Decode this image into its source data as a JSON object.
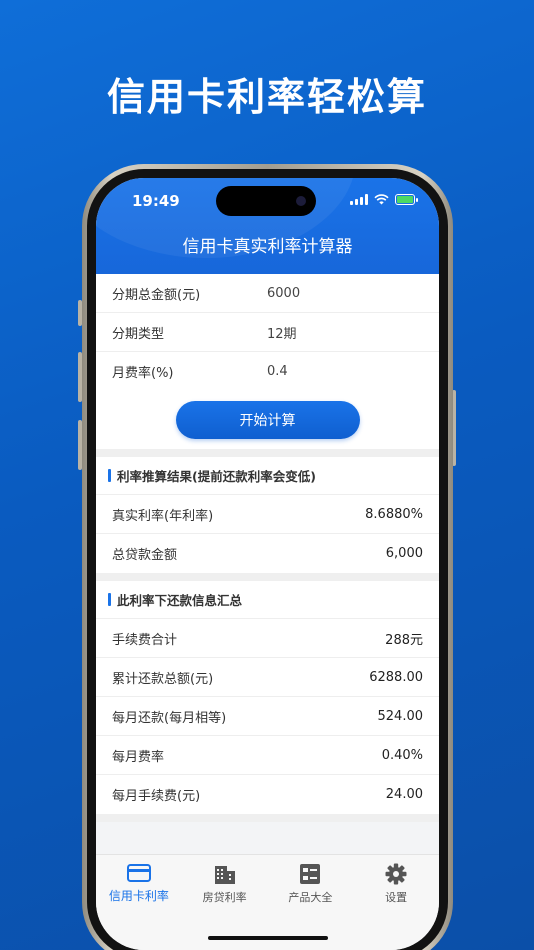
{
  "headline": "信用卡利率轻松算",
  "status": {
    "time": "19:49"
  },
  "nav": {
    "title": "信用卡真实利率计算器"
  },
  "inputs": [
    {
      "label": "分期总金额(元)",
      "value": "6000"
    },
    {
      "label": "分期类型",
      "value": "12期"
    },
    {
      "label": "月费率(%)",
      "value": "0.4"
    }
  ],
  "calc_button": "开始计算",
  "section_rate": {
    "title": "利率推算结果(提前还款利率会变低)",
    "rows": [
      {
        "label": "真实利率(年利率)",
        "value": "8.6880%"
      },
      {
        "label": "总贷款金额",
        "value": "6,000"
      }
    ]
  },
  "section_summary": {
    "title": "此利率下还款信息汇总",
    "rows": [
      {
        "label": "手续费合计",
        "value": "288元"
      },
      {
        "label": "累计还款总额(元)",
        "value": "6288.00"
      },
      {
        "label": "每月还款(每月相等)",
        "value": "524.00"
      },
      {
        "label": "每月费率",
        "value": "0.40%"
      },
      {
        "label": "每月手续费(元)",
        "value": "24.00"
      }
    ]
  },
  "tabs": [
    {
      "label": "信用卡利率",
      "icon": "credit-card-icon",
      "active": true
    },
    {
      "label": "房贷利率",
      "icon": "building-icon",
      "active": false
    },
    {
      "label": "产品大全",
      "icon": "list-icon",
      "active": false
    },
    {
      "label": "设置",
      "icon": "gear-icon",
      "active": false
    }
  ],
  "colors": {
    "accent": "#1a73e8",
    "background": "#0b5bc0"
  }
}
